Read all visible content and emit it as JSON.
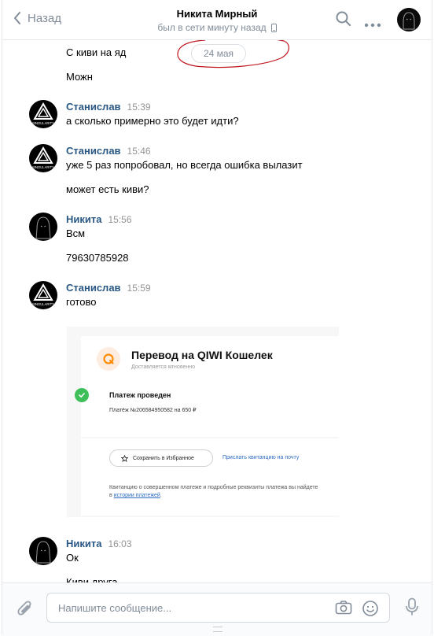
{
  "header": {
    "back_label": "Назад",
    "contact_name": "Никита Мирный",
    "contact_status": "был в сети минуту назад"
  },
  "feed": {
    "top_lines": [
      "С киви на яд",
      "Можн"
    ],
    "date_separator": "24 мая",
    "groups": [
      {
        "author": "Станислав",
        "time": "15:39",
        "lines": [
          "а сколько примерно это будет идти?"
        ]
      },
      {
        "author": "Станислав",
        "time": "15:46",
        "lines": [
          "уже 5 раз попробовал, но всегда ошибка вылазит",
          "может есть киви?"
        ]
      },
      {
        "author": "Никита",
        "time": "15:56",
        "lines": [
          "Всм",
          "79630785928"
        ]
      },
      {
        "author": "Станислав",
        "time": "15:59",
        "lines": [
          "готово"
        ]
      },
      {
        "author": "Никита",
        "time": "16:03",
        "lines": [
          "Ок",
          "Киви друга"
        ]
      }
    ],
    "avatar_label": "SINGULARITY"
  },
  "receipt": {
    "title": "Перевод на QIWI Кошелек",
    "subtitle": "Доставляется мгновенно",
    "status": "Платеж проведен",
    "payment": "Платёж №206584950582 на 650 ₽",
    "favorite_label": "Сохранить в Избранное",
    "email_link": "Прислать квитанцию на почту",
    "note_prefix": "Квитанцию о совершенном платеже и подробные реквизиты платежа вы найдете в ",
    "note_link": "истории платежей",
    "note_suffix": "."
  },
  "composer": {
    "placeholder": "Напишите сообщение..."
  },
  "colors": {
    "accent": "#2a5885",
    "muted": "#818c99",
    "scribble": "#c0141c",
    "success": "#3fbf5a",
    "qiwi": "#ff8c00"
  }
}
